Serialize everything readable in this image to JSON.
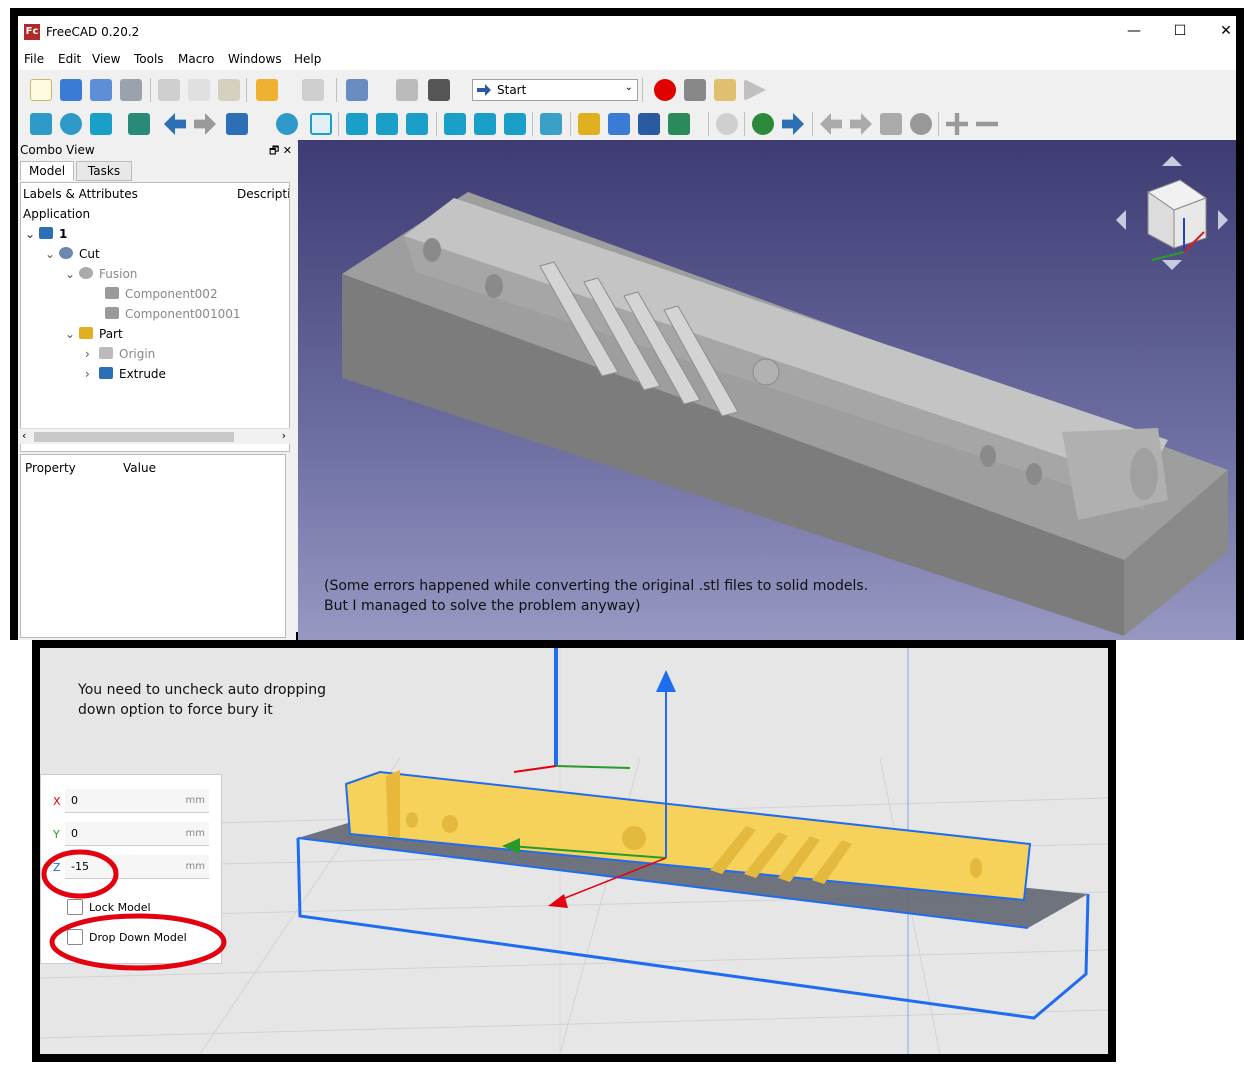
{
  "freecad": {
    "title": "FreeCAD 0.20.2",
    "logo_text": "Fc",
    "window_controls": {
      "minimize": "—",
      "maximize": "☐",
      "close": "✕"
    },
    "menu": [
      "File",
      "Edit",
      "View",
      "Tools",
      "Macro",
      "Windows",
      "Help"
    ],
    "workbench": "Start",
    "combo_view": {
      "title": "Combo View",
      "buttons": "🗗  ✕",
      "tabs": [
        "Model",
        "Tasks"
      ],
      "tree_headers": [
        "Labels & Attributes",
        "Descriptio"
      ],
      "section": "Application",
      "tree": [
        {
          "label": "1",
          "icon": "document-icon"
        },
        {
          "label": "Cut",
          "icon": "cut-icon"
        },
        {
          "label": "Fusion",
          "icon": "fusion-icon"
        },
        {
          "label": "Component002",
          "icon": "cube-icon"
        },
        {
          "label": "Component001001",
          "icon": "cube-icon"
        },
        {
          "label": "Part",
          "icon": "part-icon"
        },
        {
          "label": "Origin",
          "icon": "origin-icon"
        },
        {
          "label": "Extrude",
          "icon": "extrude-icon"
        }
      ],
      "property_headers": [
        "Property",
        "Value"
      ]
    },
    "viewport_note": [
      "(Some errors happened while converting the original .stl files to solid models.",
      "But I managed to solve the problem anyway)"
    ],
    "colors": {
      "viewport_top": "#3d3b72",
      "viewport_bottom": "#9798c2",
      "model": "#a9a9a9"
    }
  },
  "cura": {
    "note": [
      "You need to uncheck auto dropping",
      "down option to force bury it"
    ],
    "position": {
      "x": {
        "label": "X",
        "value": "0",
        "unit": "mm"
      },
      "y": {
        "label": "Y",
        "value": "0",
        "unit": "mm"
      },
      "z": {
        "label": "Z",
        "value": "-15",
        "unit": "mm"
      }
    },
    "lock_model": "Lock Model",
    "drop_down_model": "Drop Down Model",
    "colors": {
      "model": "#f7d25b",
      "outline": "#1f6cf0",
      "highlight": "#e3000f"
    }
  }
}
